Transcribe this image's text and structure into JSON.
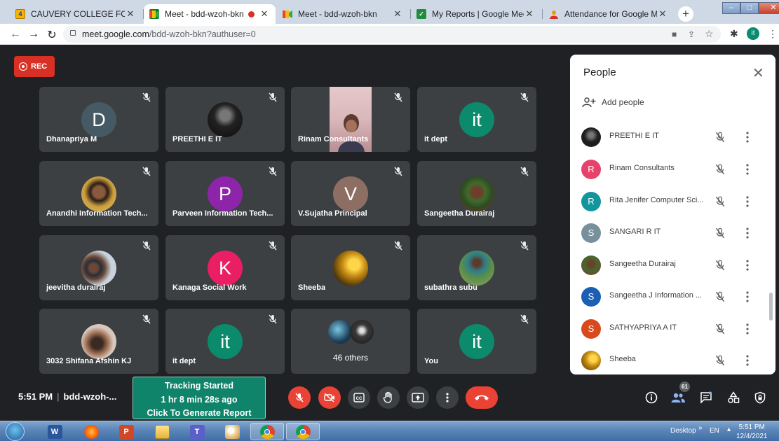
{
  "browser": {
    "tabs": [
      {
        "title": "CAUVERY COLLEGE FOR WOME",
        "favicon": "calendar-icon"
      },
      {
        "title": "Meet - bdd-wzoh-bkn",
        "favicon": "meet-icon",
        "active": true,
        "recording": true
      },
      {
        "title": "Meet - bdd-wzoh-bkn",
        "favicon": "meet-icon"
      },
      {
        "title": "My Reports | Google Meet Atte",
        "favicon": "checkmark-icon"
      },
      {
        "title": "Attendance for Google Meet™",
        "favicon": "attendance-icon"
      }
    ],
    "url_domain": "meet.google.com",
    "url_path": "/bdd-wzoh-bkn?authuser=0",
    "profile_initial": "it"
  },
  "meet": {
    "rec_label": "REC",
    "tiles": [
      {
        "name": "Dhanapriya M",
        "initial": "D"
      },
      {
        "name": "PREETHI E IT"
      },
      {
        "name": "Rinam Consultants"
      },
      {
        "name": "it dept",
        "initial": "it"
      },
      {
        "name": "Anandhi Information Tech..."
      },
      {
        "name": "Parveen Information Tech...",
        "initial": "P"
      },
      {
        "name": "V.Sujatha Principal",
        "initial": "V"
      },
      {
        "name": "Sangeetha Durairaj"
      },
      {
        "name": "jeevitha durairaj"
      },
      {
        "name": "Kanaga Social Work",
        "initial": "K"
      },
      {
        "name": "Sheeba"
      },
      {
        "name": "subathra subu"
      },
      {
        "name": "3032 Shifana Afshin KJ"
      },
      {
        "name": "it dept",
        "initial": "it"
      },
      {
        "others": "46 others"
      },
      {
        "name": "You",
        "initial": "it"
      }
    ],
    "bottom": {
      "time": "5:51 PM",
      "meeting_code": "bdd-wzoh-..."
    },
    "tracking": {
      "line1": "Tracking Started",
      "line2": "1 hr 8 min 28s ago",
      "line3": "Click To Generate Report"
    },
    "participant_count": "61"
  },
  "people_panel": {
    "title": "People",
    "add_people": "Add people",
    "participants": [
      {
        "name": "PREETHI E IT",
        "avatar": "photo"
      },
      {
        "name": "Rinam Consultants",
        "initial": "R",
        "color": "#e8416b"
      },
      {
        "name": "Rita Jenifer Computer Sci...",
        "initial": "R",
        "color": "#12959c"
      },
      {
        "name": "SANGARI R IT",
        "initial": "S",
        "color": "#78909c"
      },
      {
        "name": "Sangeetha Durairaj",
        "avatar": "photo"
      },
      {
        "name": "Sangeetha J Information ...",
        "initial": "S",
        "color": "#1a5fb4"
      },
      {
        "name": "SATHYAPRIYA A IT",
        "initial": "S",
        "color": "#d84a1b"
      },
      {
        "name": "Sheeba",
        "avatar": "photo"
      }
    ]
  },
  "taskbar": {
    "apps": [
      "start-orb",
      "word",
      "firefox",
      "powerpoint",
      "file-explorer",
      "teams",
      "paint",
      "chrome",
      "chrome-profile"
    ],
    "desktop_label": "Desktop",
    "language": "EN",
    "time": "5:51 PM",
    "date": "12/4/2021"
  },
  "colors": {
    "meet_bg": "#202124",
    "tile_bg": "#3c4043",
    "red": "#ea4335",
    "tracking_green": "#10846a",
    "tab_strip": "#cfd9e6"
  }
}
